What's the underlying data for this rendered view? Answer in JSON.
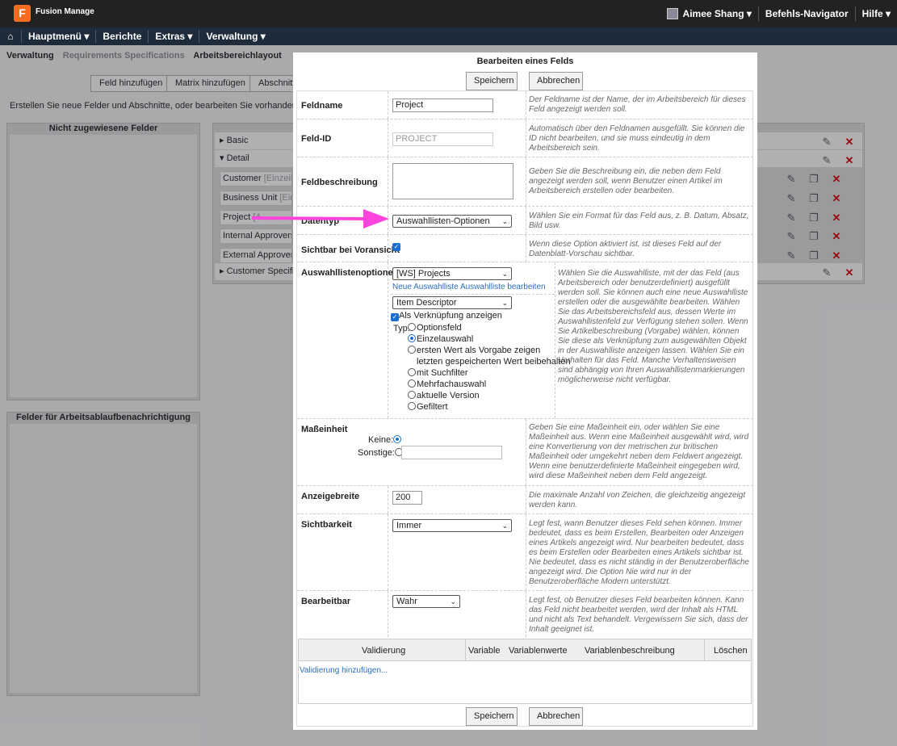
{
  "topbar": {
    "app_name": "Fusion Manage",
    "logo_letter": "F",
    "user": "Aimee Shang",
    "nav_command": "Befehls-Navigator",
    "help": "Hilfe"
  },
  "navbar": {
    "items": [
      "Hauptmenü",
      "Berichte",
      "Extras",
      "Verwaltung"
    ]
  },
  "breadcrumb": [
    "Verwaltung",
    "Requirements Specifications",
    "Arbeitsbereichlayout"
  ],
  "background": {
    "buttons": [
      "Feld hinzufügen",
      "Matrix hinzufügen",
      "Abschnitt h"
    ],
    "instructions": "Erstellen Sie neue Felder und Abschnitte, oder bearbeiten Sie vorhandene. Ziehen",
    "unassigned_title": "Nicht zugewiesene Felder",
    "workflow_title": "Felder für Arbeitsablaufbenachrichtigung",
    "sections": [
      "Basic",
      "Detail",
      "Customer Specifica"
    ],
    "fields": [
      {
        "name": "Customer",
        "type": "[Einzeilig"
      },
      {
        "name": "Business Unit",
        "type": "[Einze"
      },
      {
        "name": "Project",
        "type": "[A"
      },
      {
        "name": "Internal Approvers",
        "type": "[S"
      },
      {
        "name": "External Approvers",
        "type": "["
      }
    ]
  },
  "modal": {
    "title": "Bearbeiten eines Felds",
    "save": "Speichern",
    "cancel": "Abbrechen",
    "rows": {
      "feldname": {
        "label": "Feldname",
        "value": "Project",
        "desc": "Der Feldname ist der Name, der im Arbeitsbereich für dieses Feld angezeigt werden soll."
      },
      "feldid": {
        "label": "Feld-ID",
        "placeholder": "PROJECT",
        "desc": "Automatisch über den Feldnamen ausgefüllt. Sie können die ID nicht bearbeiten, und sie muss eindeutig in dem Arbeitsbereich sein."
      },
      "beschreibung": {
        "label": "Feldbeschreibung",
        "desc": "Geben Sie die Beschreibung ein, die neben dem Feld angezeigt werden soll, wenn Benutzer einen Artikel im Arbeitsbereich erstellen oder bearbeiten."
      },
      "datentyp": {
        "label": "Datentyp",
        "value": "Auswahllisten-Optionen",
        "desc": "Wählen Sie ein Format für das Feld aus, z. B. Datum, Absatz, Bild usw."
      },
      "sichtbar": {
        "label": "Sichtbar bei Voransicht",
        "desc": "Wenn diese Option aktiviert ist, ist dieses Feld auf der Datenblatt-Vorschau sichtbar."
      },
      "auswahl": {
        "label": "Auswahllistenoptionen",
        "list_value": "[WS] Projects",
        "link_new": "Neue Auswahlliste",
        "link_edit": "Auswahlliste bearbeiten",
        "field_value": "Item Descriptor",
        "as_link": "Als Verknüpfung anzeigen",
        "typ_label": "Typ:",
        "options": [
          "Optionsfeld",
          "Einzelauswahl",
          "ersten Wert als Vorgabe zeigen",
          "letzten gespeicherten Wert beibehalten",
          "mit Suchfilter",
          "Mehrfachauswahl",
          "aktuelle Version",
          "Gefiltert"
        ],
        "desc": "Wählen Sie die Auswahlliste, mit der das Feld (aus Arbeitsbereich oder benutzerdefiniert) ausgefüllt werden soll. Sie können auch eine neue Auswahlliste erstellen oder die ausgewählte bearbeiten. Wählen Sie das Arbeitsbereichsfeld aus, dessen Werte im Auswahllistenfeld zur Verfügung stehen sollen. Wenn Sie Artikelbeschreibung (Vorgabe) wählen, können Sie diese als Verknüpfung zum ausgewählten Objekt in der Auswahlliste anzeigen lassen. Wählen Sie ein Verhalten für das Feld. Manche Verhaltensweisen sind abhängig von Ihren Auswahllistenmarkierungen möglicherweise nicht verfügbar."
      },
      "masseinheit": {
        "label": "Maßeinheit",
        "none": "Keine:",
        "other": "Sonstige:",
        "desc": "Geben Sie eine Maßeinheit ein, oder wählen Sie eine Maßeinheit aus. Wenn eine Maßeinheit ausgewählt wird, wird eine Konvertierung von der metrischen zur britischen Maßeinheit oder umgekehrt neben dem Feldwert angezeigt. Wenn eine benutzerdefinierte Maßeinheit eingegeben wird, wird diese Maßeinheit neben dem Feld angezeigt."
      },
      "anzeigebreite": {
        "label": "Anzeigebreite",
        "value": "200",
        "desc": "Die maximale Anzahl von Zeichen, die gleichzeitig angezeigt werden kann."
      },
      "sichtbarkeit": {
        "label": "Sichtbarkeit",
        "value": "Immer",
        "desc": "Legt fest, wann Benutzer dieses Feld sehen können. Immer bedeutet, dass es beim Erstellen, Bearbeiten oder Anzeigen eines Artikels angezeigt wird. Nur bearbeiten bedeutet, dass es beim Erstellen oder Bearbeiten eines Artikels sichtbar ist. Nie bedeutet, dass es nicht ständig in der Benutzeroberfläche angezeigt wird. Die Option Nie wird nur in der Benutzeroberfläche Modern unterstützt."
      },
      "bearbeitbar": {
        "label": "Bearbeitbar",
        "value": "Wahr",
        "desc": "Legt fest, ob Benutzer dieses Feld bearbeiten können. Kann das Feld nicht bearbeitet werden, wird der Inhalt als HTML und nicht als Text behandelt. Vergewissern Sie sich, dass der Inhalt geeignet ist."
      }
    },
    "validation": {
      "headers": [
        "Validierung",
        "Variable",
        "Variablenwerte",
        "Variablenbeschreibung",
        "Löschen"
      ],
      "add_link": "Validierung hinzufügen..."
    }
  },
  "colors": {
    "accent": "#f26d21",
    "annotation_arrow": "#ff44dd",
    "nav_bg": "#1e2b3a",
    "top_bg": "#222222"
  }
}
